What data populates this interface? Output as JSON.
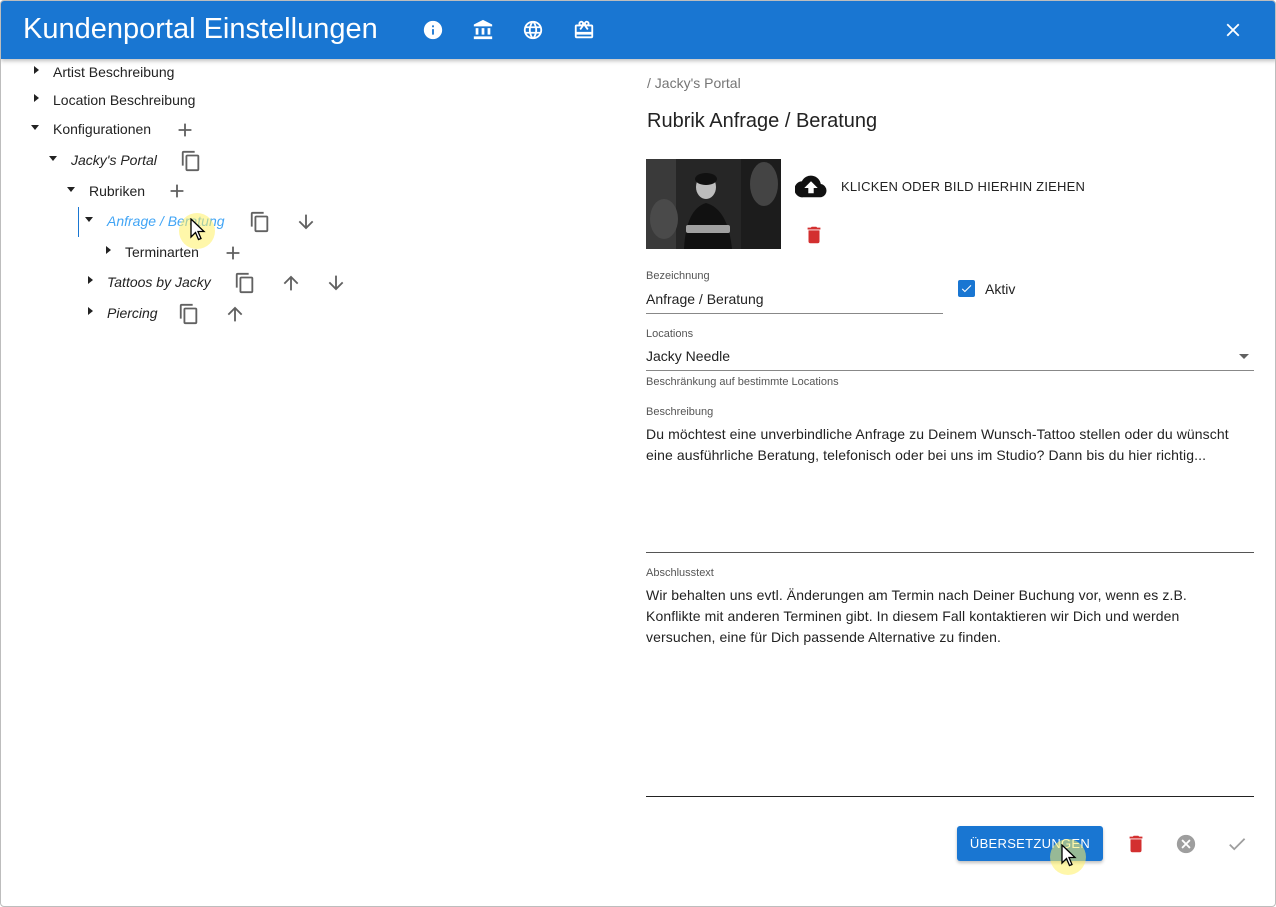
{
  "app": {
    "title": "Kundenportal Einstellungen",
    "accent": "#1976d2",
    "header_icons": [
      "info-icon",
      "bank-icon",
      "globe-icon",
      "gift-card-icon"
    ],
    "close_icon": "close-icon"
  },
  "tree": {
    "artist": "Artist Beschreibung",
    "location": "Location Beschreibung",
    "konfig": "Konfigurationen",
    "portal": "Jacky's Portal",
    "rubriken": "Rubriken",
    "anfrage": "Anfrage / Beratung",
    "terminarten": "Terminarten",
    "tattoos": "Tattoos by Jacky",
    "piercing": "Piercing"
  },
  "detail": {
    "breadcrumb": "/ Jacky's Portal",
    "title": "Rubrik Anfrage / Beratung",
    "upload_label": "KLICKEN ODER BILD HIERHIN ZIEHEN",
    "bezeichnung_label": "Bezeichnung",
    "bezeichnung_value": "Anfrage / Beratung",
    "aktiv_label": "Aktiv",
    "aktiv_checked": true,
    "locations_label": "Locations",
    "locations_value": "Jacky Needle",
    "locations_hint": "Beschränkung auf bestimmte Locations",
    "beschreibung_label": "Beschreibung",
    "beschreibung_value": "Du möchtest eine unverbindliche Anfrage zu Deinem Wunsch-Tattoo stellen oder du wünscht\neine ausführliche Beratung, telefonisch oder bei uns im Studio? Dann bis du hier richtig...",
    "abschluss_label": "Abschlusstext",
    "abschluss_value": "Wir behalten uns evtl. Änderungen am Termin nach Deiner Buchung vor, wenn es z.B.\nKonflikte mit anderen Terminen gibt. In diesem Fall kontaktieren wir Dich und werden\nversuchen, eine für Dich passende Alternative zu finden."
  },
  "actions": {
    "translations": "ÜBERSETZUNGEN",
    "delete_color": "#d32f2f"
  }
}
